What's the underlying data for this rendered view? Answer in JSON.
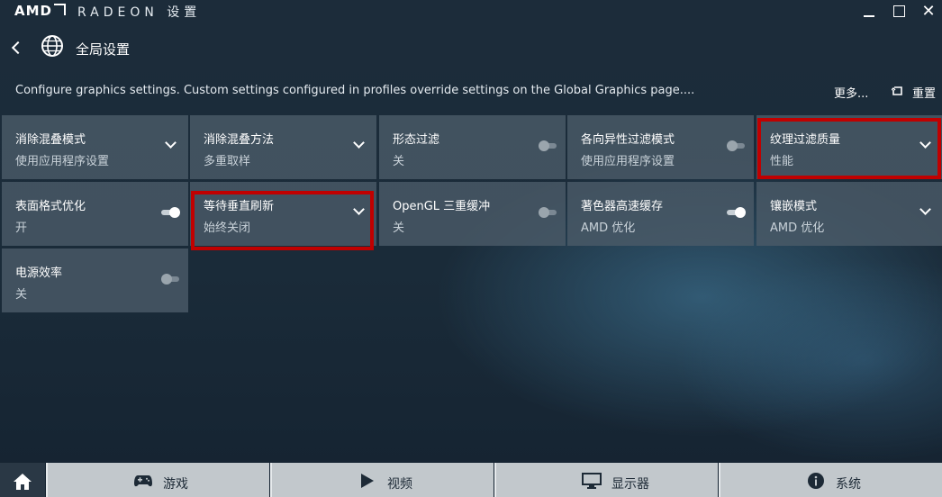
{
  "window": {
    "brand": "AMD",
    "title": "RADEON 设置",
    "minimize": "—",
    "maximize": "☐",
    "close": "✕"
  },
  "header": {
    "title": "全局设置"
  },
  "description": "Configure graphics settings. Custom settings configured in profiles override settings on the Global Graphics page....",
  "actions": {
    "more": "更多...",
    "reset": "重置"
  },
  "tiles": [
    {
      "label": "消除混叠模式",
      "value": "使用应用程序设置",
      "control": "dropdown"
    },
    {
      "label": "消除混叠方法",
      "value": "多重取样",
      "control": "dropdown"
    },
    {
      "label": "形态过滤",
      "value": "关",
      "control": "toggle",
      "on": false
    },
    {
      "label": "各向异性过滤模式",
      "value": "使用应用程序设置",
      "control": "toggle",
      "on": false
    },
    {
      "label": "纹理过滤质量",
      "value": "性能",
      "control": "dropdown",
      "highlighted": true
    },
    {
      "label": "表面格式优化",
      "value": "开",
      "control": "toggle",
      "on": true
    },
    {
      "label": "等待垂直刷新",
      "value": "始终关闭",
      "control": "dropdown",
      "highlighted": true
    },
    {
      "label": "OpenGL 三重缓冲",
      "value": "关",
      "control": "toggle",
      "on": false
    },
    {
      "label": "著色器高速缓存",
      "value": "AMD 优化",
      "control": "toggle",
      "on": true
    },
    {
      "label": "镶嵌模式",
      "value": "AMD 优化",
      "control": "dropdown"
    },
    {
      "label": "电源效率",
      "value": "关",
      "control": "toggle",
      "on": false
    }
  ],
  "highlight_color": "#c00000",
  "bottom_nav": [
    {
      "label": "游戏",
      "icon": "gamepad-icon"
    },
    {
      "label": "视频",
      "icon": "play-icon"
    },
    {
      "label": "显示器",
      "icon": "monitor-icon"
    },
    {
      "label": "系统",
      "icon": "info-icon"
    }
  ]
}
